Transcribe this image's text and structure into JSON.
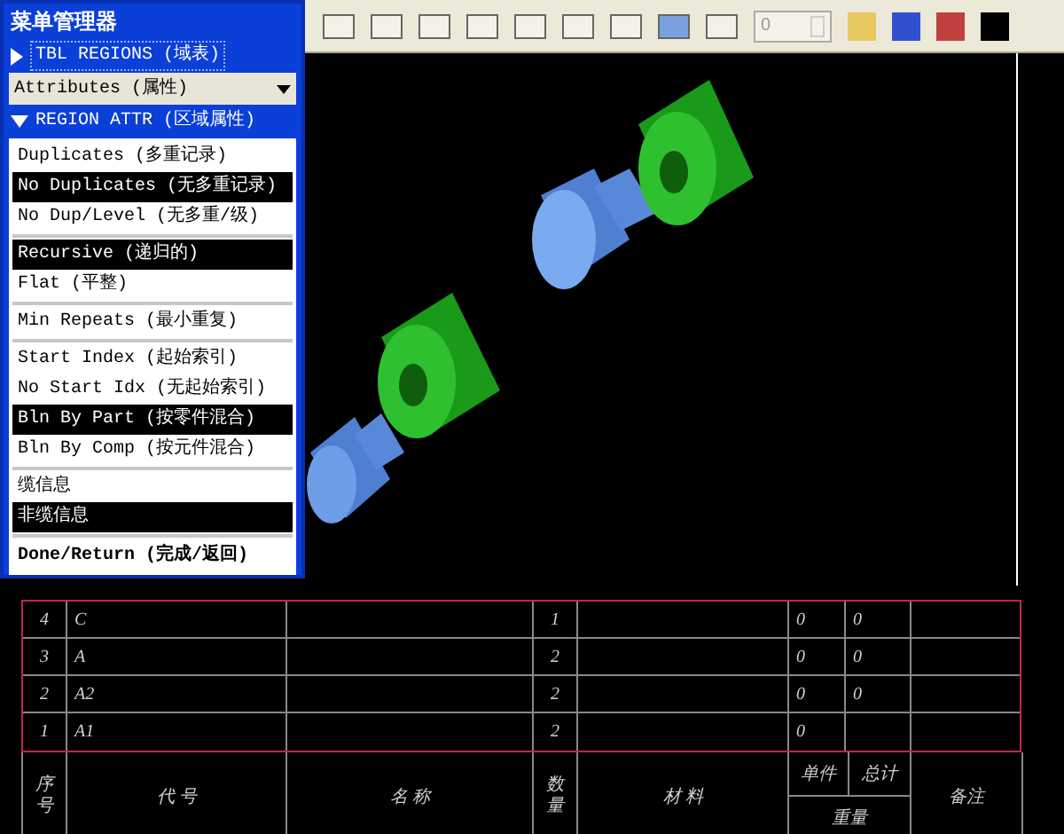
{
  "menu_manager": {
    "title": "菜单管理器",
    "sections": [
      {
        "label": "TBL REGIONS (域表)",
        "expanded": false
      }
    ],
    "dropdown": {
      "value": "Attributes (属性)"
    },
    "submenu": {
      "label": "REGION ATTR (区域属性)",
      "expanded": true
    },
    "groups": [
      [
        {
          "label": "Duplicates (多重记录)",
          "selected": false
        },
        {
          "label": "No Duplicates (无多重记录)",
          "selected": true
        },
        {
          "label": "No Dup/Level (无多重/级)",
          "selected": false
        }
      ],
      [
        {
          "label": "Recursive (递归的)",
          "selected": true
        },
        {
          "label": "Flat (平整)",
          "selected": false
        }
      ],
      [
        {
          "label": "Min Repeats (最小重复)",
          "selected": false
        }
      ],
      [
        {
          "label": "Start Index (起始索引)",
          "selected": false
        },
        {
          "label": "No Start Idx (无起始索引)",
          "selected": false
        },
        {
          "label": "Bln By Part (按零件混合)",
          "selected": true
        },
        {
          "label": "Bln By Comp (按元件混合)",
          "selected": false
        }
      ],
      [
        {
          "label": "缆信息",
          "selected": false
        },
        {
          "label": "非缆信息",
          "selected": true
        }
      ]
    ],
    "done": "Done/Return (完成/返回)"
  },
  "toolbar": {
    "spin_value": "0"
  },
  "table": {
    "rows": [
      [
        "4",
        "C",
        "",
        "1",
        "",
        "0",
        "0",
        ""
      ],
      [
        "3",
        "A",
        "",
        "2",
        "",
        "0",
        "0",
        ""
      ],
      [
        "2",
        "A2",
        "",
        "2",
        "",
        "0",
        "0",
        ""
      ],
      [
        "1",
        "A1",
        "",
        "2",
        "",
        "0",
        "",
        ""
      ]
    ],
    "header": {
      "index": "序号",
      "code": "代 号",
      "name": "名 称",
      "qty": "数量",
      "material": "材 料",
      "unit": "单件",
      "total": "总计",
      "weight": "重量",
      "remark": "备注"
    }
  }
}
